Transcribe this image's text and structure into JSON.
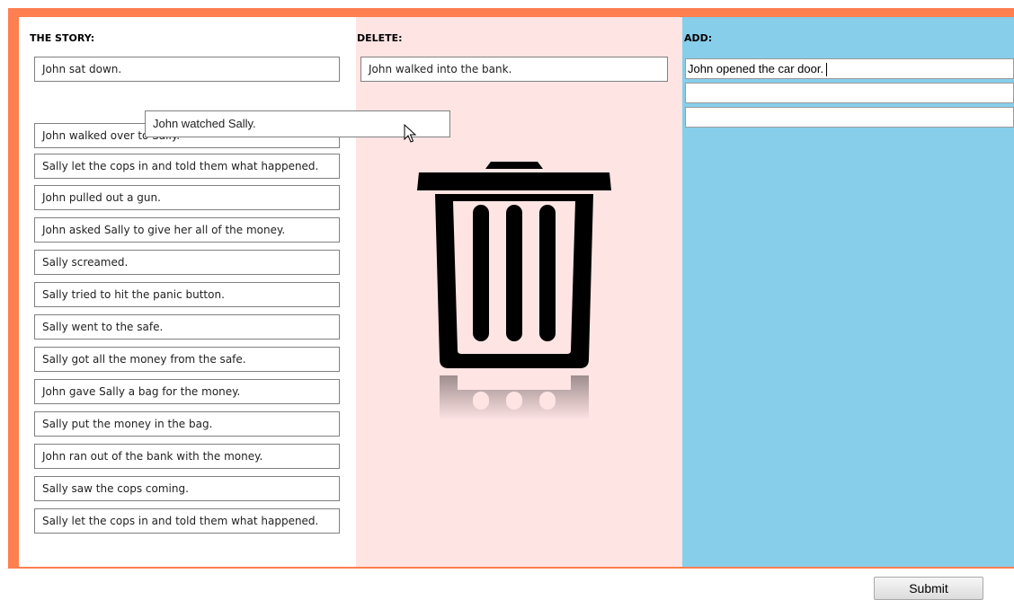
{
  "story": {
    "heading": "THE STORY:",
    "items": [
      "John sat down.",
      "John walked over to Sally.",
      "Sally let the cops in and told them what happened.",
      "John pulled out a gun.",
      "John asked Sally to give her all of the money.",
      "Sally screamed.",
      "Sally tried to hit the panic button.",
      "Sally went to the safe.",
      "Sally got all the money from the safe.",
      "John gave Sally a bag for the money.",
      "Sally put the money in the bag.",
      "John ran out of the bank with the money.",
      "Sally saw the cops coming.",
      "Sally let the cops in and told them what happened."
    ]
  },
  "dragging": {
    "label": "John watched Sally."
  },
  "delete": {
    "heading": "DELETE:",
    "items": [
      "John walked into the bank."
    ],
    "icon": "trash-icon"
  },
  "add": {
    "heading": "ADD:",
    "inputs": [
      "John opened the car door.",
      "",
      ""
    ]
  },
  "submit_label": "Submit",
  "colors": {
    "frame": "#ff7f50",
    "delete_bg": "#ffe4e4",
    "add_bg": "#87ceeb"
  }
}
